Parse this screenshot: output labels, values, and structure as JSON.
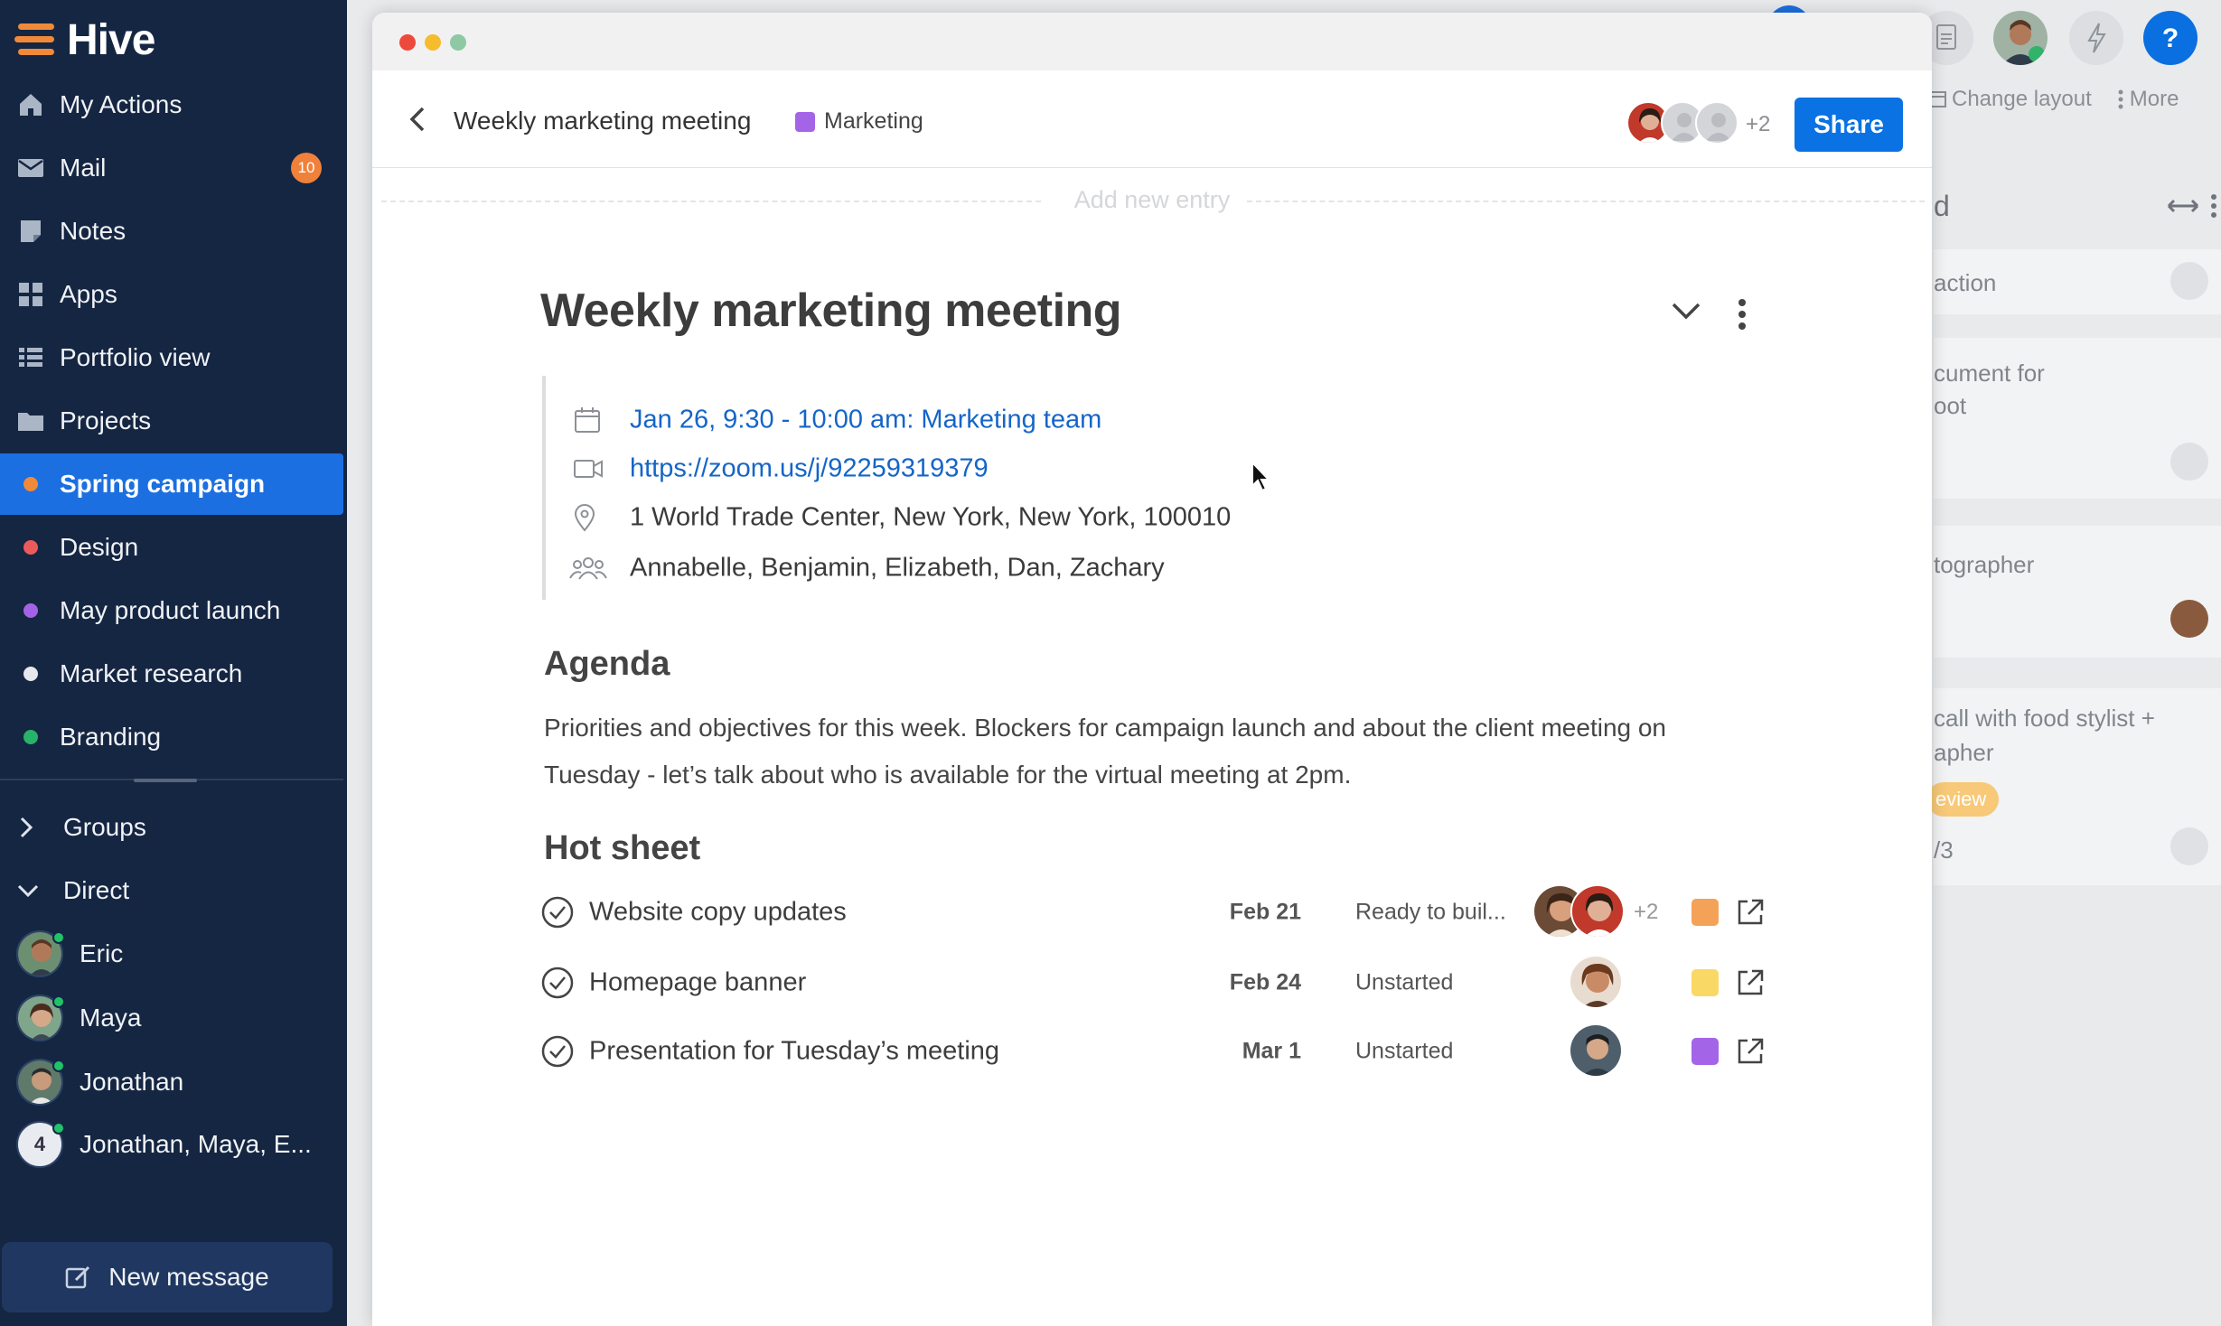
{
  "sidebar": {
    "logo": "Hive",
    "nav": [
      {
        "label": "My Actions",
        "icon": "home-icon"
      },
      {
        "label": "Mail",
        "icon": "mail-icon",
        "badge": "10"
      },
      {
        "label": "Notes",
        "icon": "note-icon"
      },
      {
        "label": "Apps",
        "icon": "apps-grid-icon"
      },
      {
        "label": "Portfolio view",
        "icon": "list-icon"
      },
      {
        "label": "Projects",
        "icon": "folder-icon"
      }
    ],
    "projects": [
      {
        "label": "Spring campaign",
        "color": "#f08a3a",
        "active": true
      },
      {
        "label": "Design",
        "color": "#ec5b5b"
      },
      {
        "label": "May product launch",
        "color": "#a463e6"
      },
      {
        "label": "Market research",
        "color": "#e6e8ec"
      },
      {
        "label": "Branding",
        "color": "#27b36a"
      }
    ],
    "groups_label": "Groups",
    "direct_label": "Direct",
    "direct": [
      {
        "label": "Eric"
      },
      {
        "label": "Maya"
      },
      {
        "label": "Jonathan"
      },
      {
        "label": "Jonathan, Maya, E...",
        "count": "4"
      }
    ],
    "new_message": "New message"
  },
  "background": {
    "toolbar": {
      "change_layout": "Change layout",
      "more": "More"
    },
    "column_title": "d",
    "cards": [
      {
        "lines": [
          "action"
        ]
      },
      {
        "lines": [
          "cument for",
          "oot"
        ]
      },
      {
        "lines": [
          "tographer"
        ]
      },
      {
        "lines": [
          "call with food stylist +",
          "apher"
        ],
        "tag": "eview",
        "progress": "/3"
      }
    ]
  },
  "modal": {
    "header": {
      "title": "Weekly marketing meeting",
      "tag": "Marketing",
      "tag_color": "#a464e8",
      "avatars_more": "+2",
      "share": "Share"
    },
    "add_entry": "Add new entry",
    "doc_title": "Weekly marketing meeting",
    "event": {
      "time": "Jan 26, 9:30 - 10:00 am: Marketing team",
      "link": "https://zoom.us/j/92259319379",
      "location": "1 World Trade Center, New York, New York, 100010",
      "attendees": "Annabelle, Benjamin, Elizabeth, Dan, Zachary"
    },
    "agenda_heading": "Agenda",
    "agenda_text": "Priorities and objectives for this week. Blockers for campaign launch and about the client meeting on Tuesday - let’s talk about who is available for the virtual meeting at 2pm.",
    "hot_sheet_heading": "Hot sheet",
    "hot_sheet": [
      {
        "name": "Website copy updates",
        "date": "Feb 21",
        "status": "Ready to buil...",
        "more": "+2",
        "color": "#f5a259"
      },
      {
        "name": "Homepage banner",
        "date": "Feb 24",
        "status": "Unstarted",
        "more": "",
        "color": "#fad866"
      },
      {
        "name": "Presentation for Tuesday’s meeting",
        "date": "Mar 1",
        "status": "Unstarted",
        "more": "",
        "color": "#a464e8"
      }
    ]
  }
}
